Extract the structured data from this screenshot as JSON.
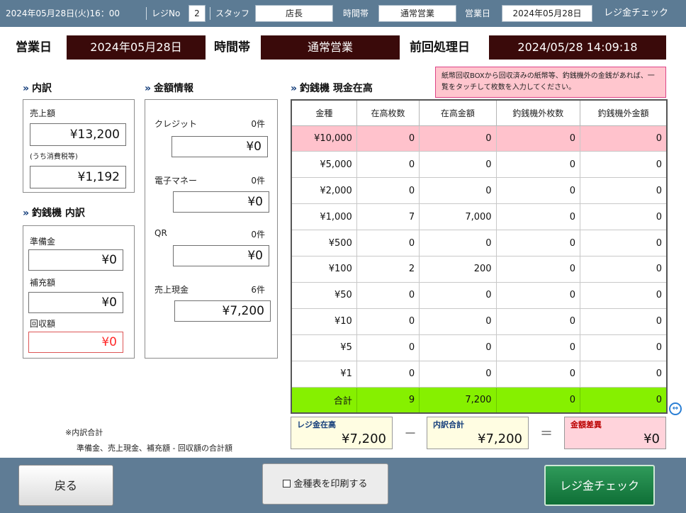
{
  "topbar": {
    "datetime": "2024年05月28日(火)16：00",
    "register_label": "レジNo",
    "register_no": "2",
    "staff_label": "スタッフ",
    "staff_value": "店長",
    "time_slot_label": "時間帯",
    "time_slot_value": "通常営業",
    "business_day_label": "営業日",
    "business_day_value": "2024年05月28日",
    "screen_title": "レジ金チェック"
  },
  "header": {
    "business_day_label": "営業日",
    "business_day_value": "2024年05月28日",
    "time_slot_label": "時間帯",
    "time_slot_value": "通常営業",
    "last_processed_label": "前回処理日",
    "last_processed_value": "2024/05/28 14:09:18"
  },
  "breakdown": {
    "title": "内訳",
    "sales_label": "売上額",
    "sales_value": "¥13,200",
    "tax_label": "(うち消費税等)",
    "tax_value": "¥1,192"
  },
  "changer_breakdown": {
    "title": "釣銭機 内訳",
    "reserve_label": "準備金",
    "reserve_value": "¥0",
    "replenish_label": "補充額",
    "replenish_value": "¥0",
    "collect_label": "回収額",
    "collect_value": "¥0"
  },
  "amount_info": {
    "title": "金額情報",
    "credit_label": "クレジット",
    "credit_count": "0件",
    "credit_value": "¥0",
    "emoney_label": "電子マネー",
    "emoney_count": "0件",
    "emoney_value": "¥0",
    "qr_label": "QR",
    "qr_count": "0件",
    "qr_value": "¥0",
    "cash_label": "売上現金",
    "cash_count": "6件",
    "cash_value": "¥7,200"
  },
  "cash_stock": {
    "title": "釣銭機 現金在高",
    "note": "紙幣回収BOXから回収済みの紙幣等、釣銭機外の金銭があれば、一覧をタッチして枚数を入力してください。",
    "columns": [
      "金種",
      "在高枚数",
      "在高金額",
      "釣銭機外枚数",
      "釣銭機外金額"
    ],
    "rows": [
      [
        "¥10,000",
        "0",
        "0",
        "0",
        "0"
      ],
      [
        "¥5,000",
        "0",
        "0",
        "0",
        "0"
      ],
      [
        "¥2,000",
        "0",
        "0",
        "0",
        "0"
      ],
      [
        "¥1,000",
        "7",
        "7,000",
        "0",
        "0"
      ],
      [
        "¥500",
        "0",
        "0",
        "0",
        "0"
      ],
      [
        "¥100",
        "2",
        "200",
        "0",
        "0"
      ],
      [
        "¥50",
        "0",
        "0",
        "0",
        "0"
      ],
      [
        "¥10",
        "0",
        "0",
        "0",
        "0"
      ],
      [
        "¥5",
        "0",
        "0",
        "0",
        "0"
      ],
      [
        "¥1",
        "0",
        "0",
        "0",
        "0"
      ]
    ],
    "total": [
      "合計",
      "9",
      "7,200",
      "0",
      "0"
    ]
  },
  "summary": {
    "register_stock_label": "レジ金在高",
    "register_stock_value": "¥7,200",
    "minus": "－",
    "breakdown_total_label": "内訳合計",
    "breakdown_total_value": "¥7,200",
    "equals": "＝",
    "difference_label": "金額差異",
    "difference_value": "¥0"
  },
  "footnote": {
    "line1": "※内訳合計",
    "line2": "準備金、売上現金、補充額 - 回収額の合計額"
  },
  "footer": {
    "back_label": "戻る",
    "print_label": "金種表を印刷する",
    "check_label": "レジ金チェック"
  },
  "colors": {
    "topbar": "#5c7b94",
    "header_box": "#3a0a0a",
    "highlight_row": "#ffc2cc",
    "total_row": "#86f000",
    "check_button": "#0f6f36"
  }
}
